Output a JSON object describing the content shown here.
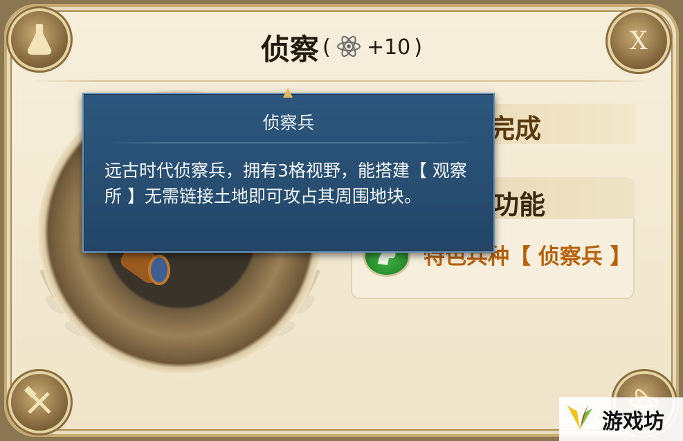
{
  "header": {
    "title": "侦察",
    "bonus_open": "(",
    "bonus_value": "+10",
    "bonus_close": ")",
    "bonus_icon": "atom-icon"
  },
  "corners": {
    "top_left_icon": "potion-flask-icon",
    "close_label": "X",
    "bottom_left_icon": "wrench-hammer-icon",
    "bottom_right_icon": "atom-emblem-icon"
  },
  "tech_icon": "telescope-icon",
  "status": {
    "text": "完成"
  },
  "function_section": {
    "title": "功能",
    "unit_icon": "horse-unit-icon",
    "unit_label": "特色兵种【 侦察兵 】"
  },
  "tooltip": {
    "title": "侦察兵",
    "description": "远古时代侦察兵，拥有3格视野，能搭建【 观察所 】无需链接土地即可攻占其周围地块。"
  },
  "watermark": {
    "text": "游戏坊"
  },
  "colors": {
    "panel_bg": "#f3ead4",
    "frame_gold": "#c7ab73",
    "tooltip_blue": "#2a5279",
    "accent_orange": "#b6600a",
    "unit_green": "#2f9a34"
  }
}
